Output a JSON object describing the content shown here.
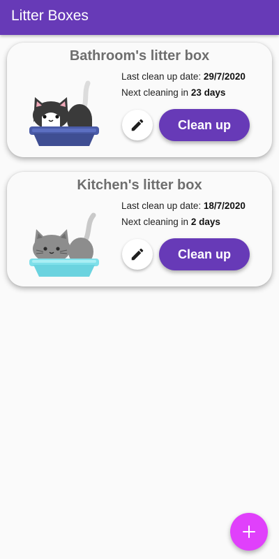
{
  "app_bar": {
    "title": "Litter Boxes"
  },
  "boxes": [
    {
      "title": "Bathroom's litter box",
      "last_label": "Last clean up date: ",
      "last_date": "29/7/2020",
      "next_label": "Next cleaning in ",
      "next_value": "23 days",
      "edit_icon": "pencil-icon",
      "clean_label": "Clean up"
    },
    {
      "title": "Kitchen's litter box",
      "last_label": "Last clean up date: ",
      "last_date": "18/7/2020",
      "next_label": "Next cleaning in ",
      "next_value": "2 days",
      "edit_icon": "pencil-icon",
      "clean_label": "Clean up"
    }
  ],
  "fab": {
    "icon": "plus-icon"
  },
  "colors": {
    "primary": "#673ab7",
    "accent": "#e040fb",
    "background": "#fafafa"
  }
}
